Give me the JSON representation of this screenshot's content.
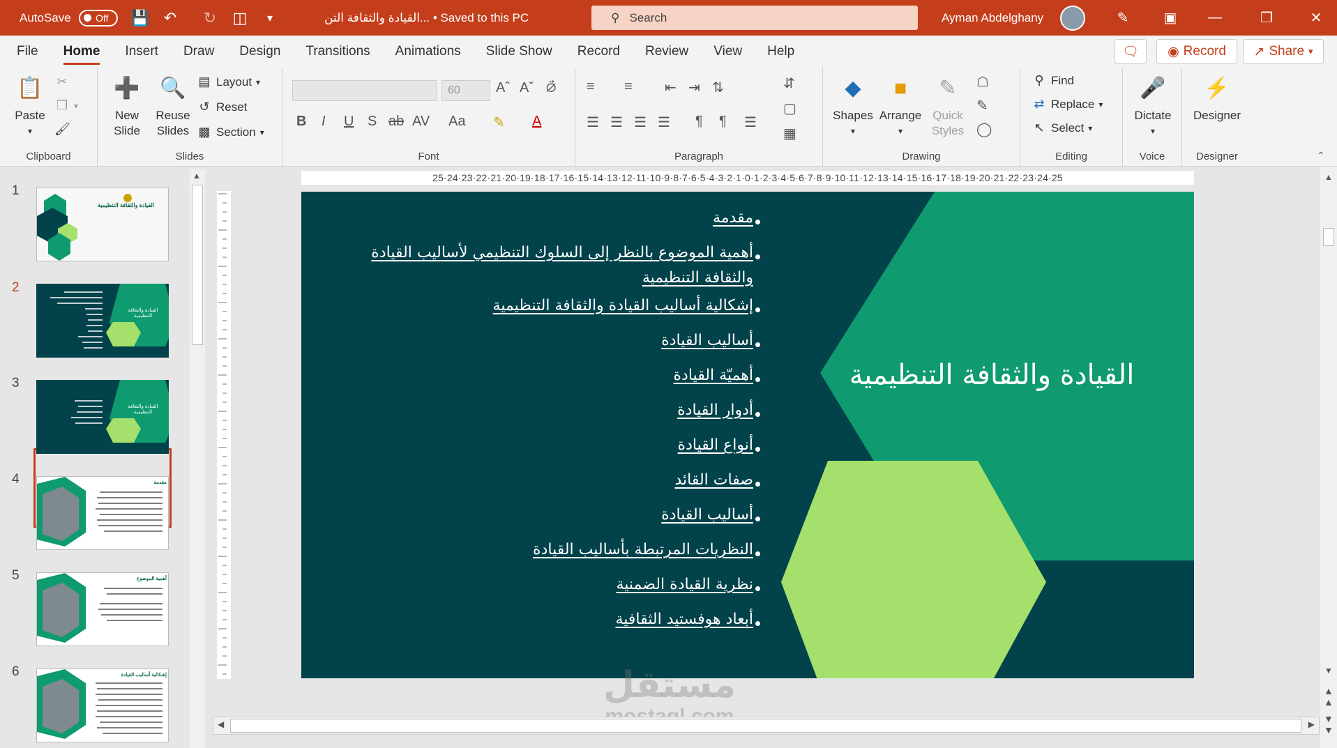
{
  "titlebar": {
    "autosave_label": "AutoSave",
    "autosave_state": "Off",
    "document": "القيادة والثقافة التن... • Saved to this PC",
    "search_placeholder": "Search",
    "user": "Ayman Abdelghany"
  },
  "tabs": [
    "File",
    "Home",
    "Insert",
    "Draw",
    "Design",
    "Transitions",
    "Animations",
    "Slide Show",
    "Record",
    "Review",
    "View",
    "Help"
  ],
  "tab_actions": {
    "record": "Record",
    "share": "Share"
  },
  "ribbon": {
    "clipboard": {
      "paste": "Paste",
      "label": "Clipboard"
    },
    "slides": {
      "new_slide": "New Slide",
      "reuse_slides": "Reuse Slides",
      "layout": "Layout",
      "reset": "Reset",
      "section": "Section",
      "label": "Slides"
    },
    "font": {
      "size": "60",
      "label": "Font"
    },
    "paragraph": {
      "label": "Paragraph"
    },
    "drawing": {
      "shapes": "Shapes",
      "arrange": "Arrange",
      "quick_styles": "Quick Styles",
      "label": "Drawing"
    },
    "editing": {
      "find": "Find",
      "replace": "Replace",
      "select": "Select",
      "label": "Editing"
    },
    "voice": {
      "dictate": "Dictate",
      "label": "Voice"
    },
    "designer": {
      "designer": "Designer",
      "label": "Designer"
    }
  },
  "thumbnails": [
    {
      "num": "1",
      "title": "القيادة والثقافة التنظيمية"
    },
    {
      "num": "2",
      "title": "القيادة والثقافة التنظيمية"
    },
    {
      "num": "3",
      "title": "القيادة والثقافة التنظيمية"
    },
    {
      "num": "4",
      "title": "مقدمة"
    },
    {
      "num": "5",
      "title": "أهمية الموضوع"
    },
    {
      "num": "6",
      "title": "إشكالية أساليب القيادة"
    }
  ],
  "ruler": {
    "horizontal": "25|24|23|22|21|20|19|18|17|16|15|14|13|12|11|10|9|8|7|6|5|4|3|2|1|0|1|2|3|4|5|6|7|8|9|10|11|12|13|14|15|16|17|18|19|20|21|22|23|24|25"
  },
  "slide": {
    "title": "القيادة والثقافة التنظيمية",
    "bullets": [
      "مقدمة",
      "أهمية الموضوع بالنظر إلى السلوك التنظيمي لأساليب القيادة والثقافة التنظيمية",
      "إشكالية أساليب القيادة والثقافة التنظيمية",
      "أساليب القيادة",
      "أهميّة القيادة",
      "أدوار القيادة",
      "أنواع القيادة",
      "صفات القائد",
      "أساليب القيادة",
      "النظريات المرتبطة بأساليب القيادة",
      "نظرية القيادة الضمنية",
      "أبعاد هوفستيد الثقافية"
    ],
    "colors": {
      "background": "#02424a",
      "teal_hex": "#0f9b6f",
      "lime_hex": "#a5e06c"
    }
  },
  "watermark": {
    "arabic": "مستقل",
    "latin": "mostaql.com"
  }
}
